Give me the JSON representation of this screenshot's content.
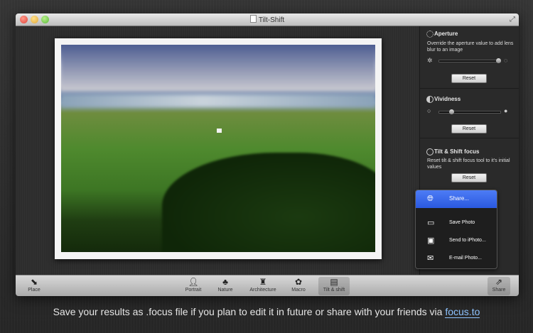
{
  "window": {
    "title": "Tilt-Shift"
  },
  "sidebar": {
    "aperture": {
      "title": "Aperture",
      "description": "Override the aperture value to add lens blur to an image",
      "reset": "Reset"
    },
    "vividness": {
      "title": "Vividness",
      "reset": "Reset"
    },
    "tiltshift": {
      "title": "Tilt & Shift focus",
      "description": "Reset tilt & shift focus tool to it's initial values",
      "reset": "Reset"
    }
  },
  "share_menu": {
    "items": [
      {
        "label": "Share...",
        "icon": "globe-icon"
      },
      {
        "label": "Save Photo",
        "icon": "disk-icon"
      },
      {
        "label": "Send to iPhoto...",
        "icon": "iphoto-icon"
      },
      {
        "label": "E-mail Photo...",
        "icon": "envelope-icon"
      }
    ]
  },
  "toolbar": {
    "place": "Place",
    "tools": [
      "Portrait",
      "Nature",
      "Architecture",
      "Macro",
      "Tilt & shift"
    ],
    "selected": "Tilt & shift",
    "share": "Share"
  },
  "caption": {
    "text": "Save your results as .focus file if you plan to edit it in future or share with your friends via ",
    "link": "focus.to"
  },
  "colors": {
    "accent": "#2a59e0",
    "link": "#8ec3ff"
  }
}
